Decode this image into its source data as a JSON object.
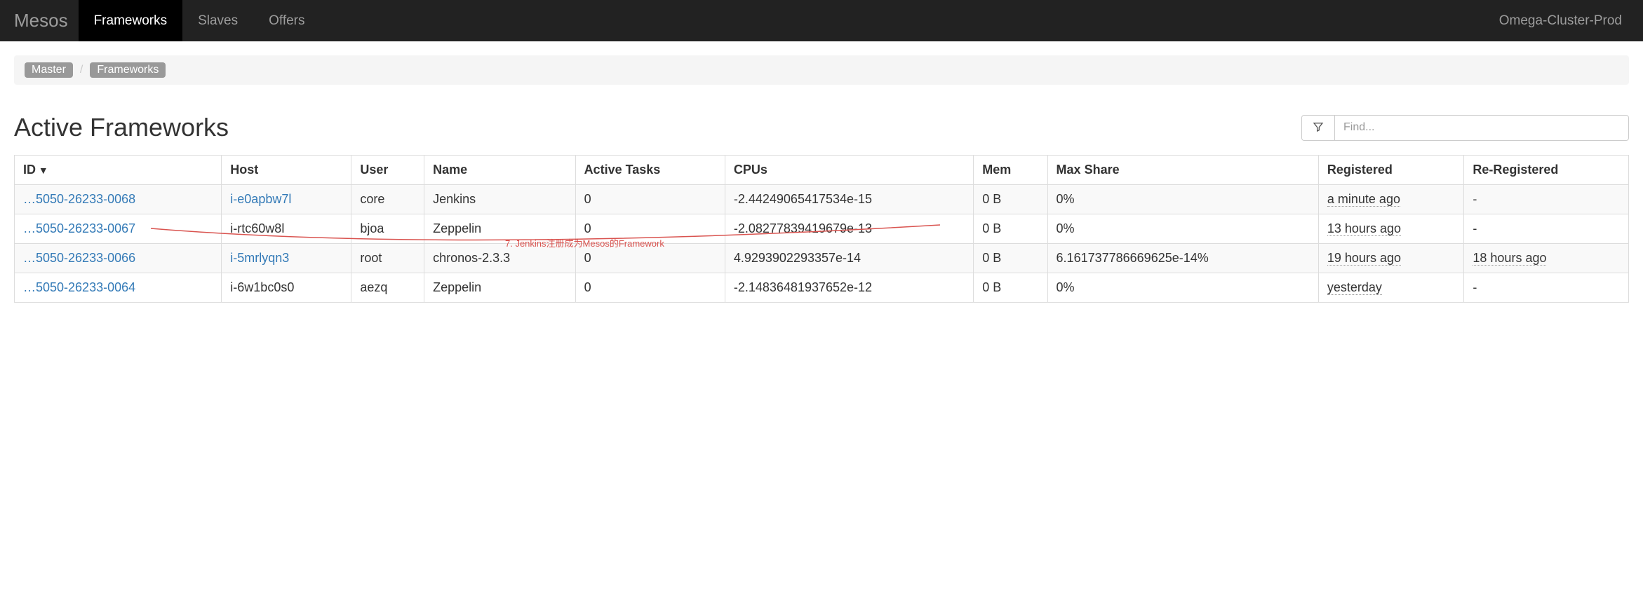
{
  "navbar": {
    "brand": "Mesos",
    "items": [
      {
        "label": "Frameworks",
        "active": true
      },
      {
        "label": "Slaves"
      },
      {
        "label": "Offers"
      }
    ],
    "cluster": "Omega-Cluster-Prod"
  },
  "breadcrumb": {
    "items": [
      "Master",
      "Frameworks"
    ]
  },
  "section": {
    "title": "Active Frameworks",
    "filter_placeholder": "Find..."
  },
  "table": {
    "columns": [
      "ID",
      "Host",
      "User",
      "Name",
      "Active Tasks",
      "CPUs",
      "Mem",
      "Max Share",
      "Registered",
      "Re-Registered"
    ],
    "sorted_col": "ID",
    "rows": [
      {
        "id": "…5050-26233-0068",
        "host": "i-e0apbw7l",
        "host_link": true,
        "user": "core",
        "name": "Jenkins",
        "active_tasks": "0",
        "cpus": "-2.44249065417534e-15",
        "mem": "0 B",
        "max_share": "0%",
        "registered": "a minute ago",
        "re_registered": "-"
      },
      {
        "id": "…5050-26233-0067",
        "host": "i-rtc60w8l",
        "host_link": false,
        "user": "bjoa",
        "name": "Zeppelin",
        "active_tasks": "0",
        "cpus": "-2.08277839419679e-13",
        "mem": "0 B",
        "max_share": "0%",
        "registered": "13 hours ago",
        "re_registered": "-"
      },
      {
        "id": "…5050-26233-0066",
        "host": "i-5mrlyqn3",
        "host_link": true,
        "user": "root",
        "name": "chronos-2.3.3",
        "active_tasks": "0",
        "cpus": "4.9293902293357e-14",
        "mem": "0 B",
        "max_share": "6.161737786669625e-14%",
        "registered": "19 hours ago",
        "re_registered": "18 hours ago"
      },
      {
        "id": "…5050-26233-0064",
        "host": "i-6w1bc0s0",
        "host_link": false,
        "user": "aezq",
        "name": "Zeppelin",
        "active_tasks": "0",
        "cpus": "-2.14836481937652e-12",
        "mem": "0 B",
        "max_share": "0%",
        "registered": "yesterday",
        "re_registered": "-"
      }
    ]
  },
  "annotation": {
    "text": "7. Jenkins注册成为Mesos的Framework"
  }
}
